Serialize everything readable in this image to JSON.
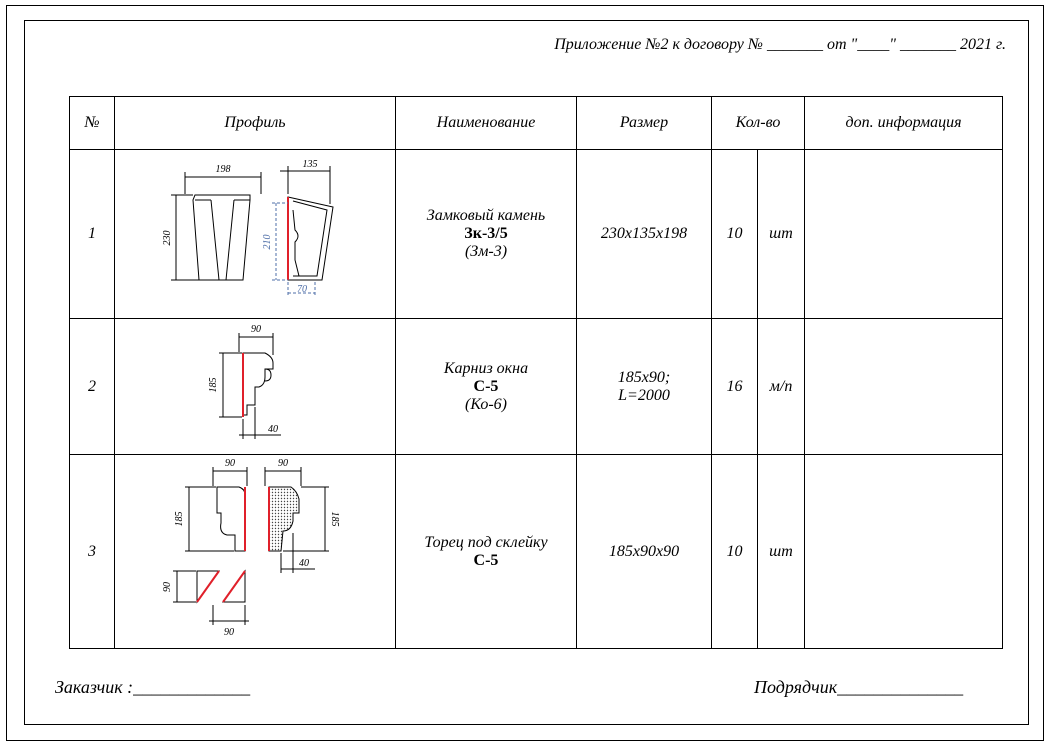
{
  "header": {
    "appendix": "Приложение №2 к договору № _______ от \"____\" _______ 2021 г."
  },
  "table": {
    "columns": [
      "№",
      "Профиль",
      "Наименование",
      "Размер",
      "Кол-во",
      "доп. информация"
    ],
    "rows": [
      {
        "num": "1",
        "name_line1": "Замковый камень",
        "name_code": "Зк-3/5",
        "name_alt": "(Зм-3)",
        "size": "230х135х198",
        "qty": "10",
        "unit": "шт",
        "extra": "",
        "dims": [
          "198",
          "135",
          "230",
          "210",
          "70"
        ]
      },
      {
        "num": "2",
        "name_line1": "Карниз окна",
        "name_code": "С-5",
        "name_alt": "(Ко-6)",
        "size_line1": "185х90;",
        "size_line2": "L=2000",
        "qty": "16",
        "unit": "м/п",
        "extra": "",
        "dims": [
          "90",
          "185",
          "40"
        ]
      },
      {
        "num": "3",
        "name_line1": "Торец под склейку",
        "name_code": "С-5",
        "size": "185х90х90",
        "qty": "10",
        "unit": "шт",
        "extra": "",
        "dims": [
          "90",
          "90",
          "185",
          "185",
          "40",
          "90",
          "90"
        ]
      }
    ]
  },
  "footer": {
    "customer": "Заказчик :_____________",
    "contractor": "Подрядчик______________"
  },
  "colors": {
    "line": "#000000",
    "accent_red": "#e0202a",
    "accent_blue": "#4f6fa8"
  }
}
